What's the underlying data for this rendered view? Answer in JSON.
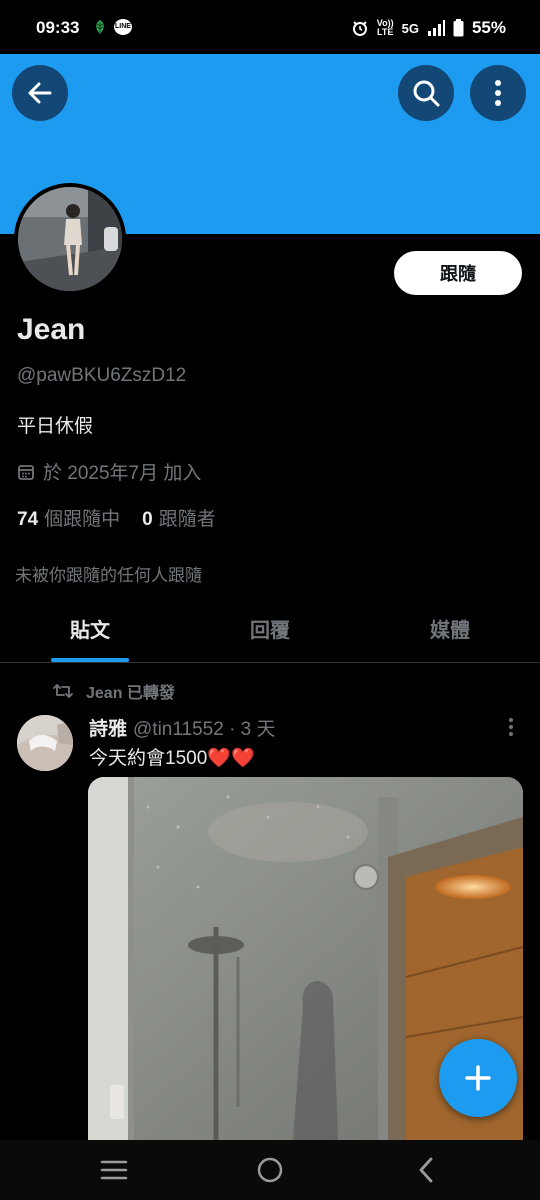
{
  "status_bar": {
    "time": "09:33",
    "line_app_label": "LINE",
    "network_top": "Vo))",
    "network_bottom": "LTE",
    "network_type": "5G",
    "battery": "55%"
  },
  "icons": {
    "back": "arrow-left-icon",
    "search": "search-icon",
    "more": "more-vertical-icon",
    "calendar": "calendar-icon",
    "repost": "repost-icon",
    "compose": "plus-icon"
  },
  "profile": {
    "follow_label": "跟隨",
    "display_name": "Jean",
    "handle": "@pawBKU6ZszD12",
    "bio": "平日休假",
    "joined": "於 2025年7月 加入",
    "following_count": "74",
    "following_label": "個跟隨中",
    "followers_count": "0",
    "followers_label": "跟隨者",
    "not_followed_note": "未被你跟隨的任何人跟隨"
  },
  "tabs": [
    {
      "label": "貼文",
      "active": true
    },
    {
      "label": "回覆",
      "active": false
    },
    {
      "label": "媒體",
      "active": false
    }
  ],
  "post": {
    "repost_label": "Jean 已轉發",
    "author": "詩雅",
    "meta": "@tin11552 · 3 天",
    "text": "今天約會1500",
    "hearts": "❤️❤️"
  },
  "colors": {
    "banner": "#1d9bf0",
    "accent": "#1d9bf0",
    "background": "#000000",
    "secondary_text": "#71767b"
  }
}
